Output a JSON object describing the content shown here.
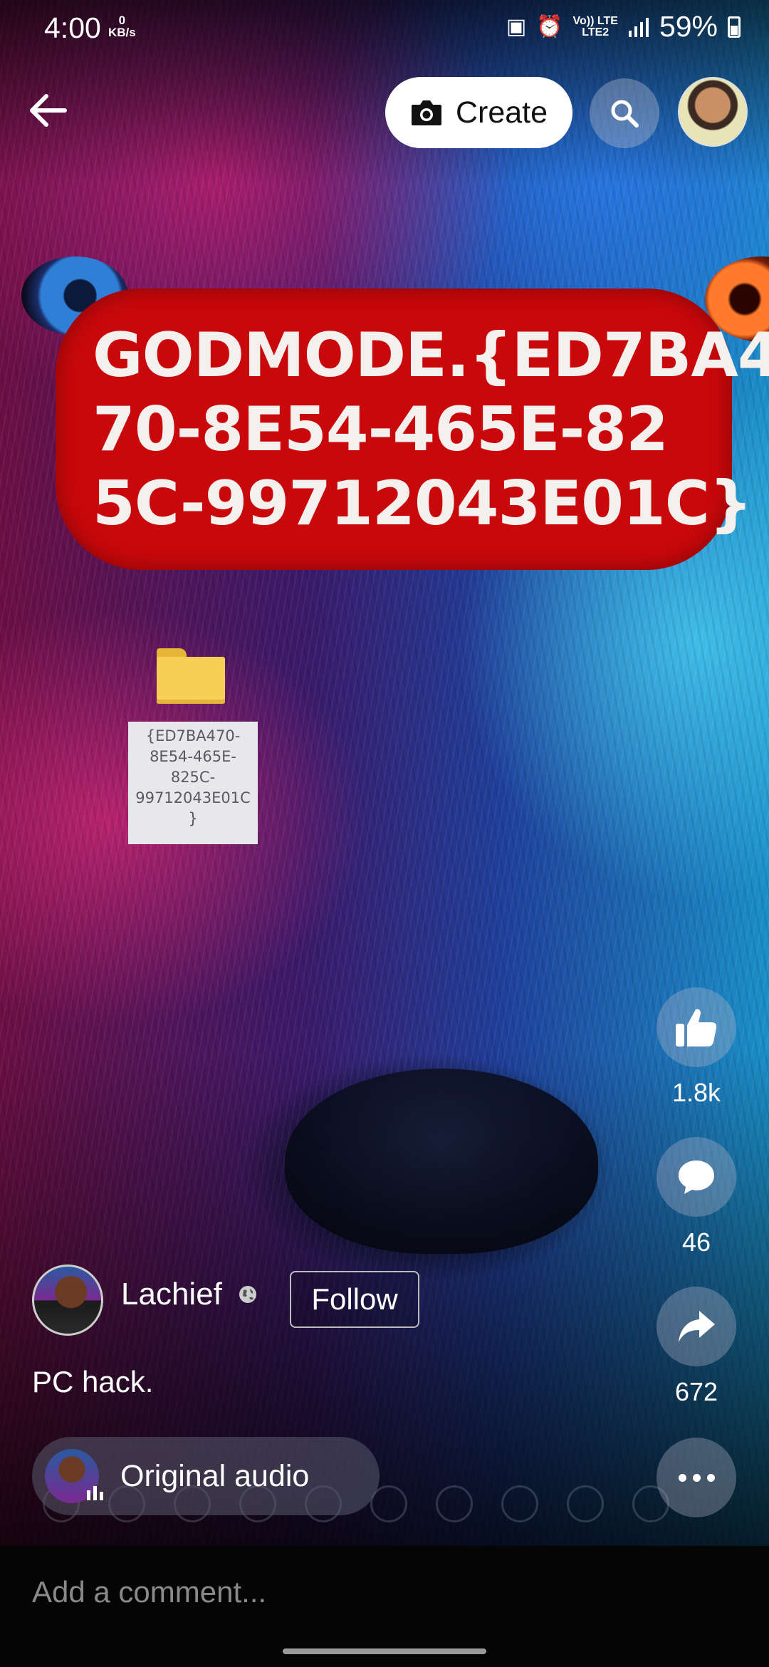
{
  "status_bar": {
    "time": "4:00",
    "net_speed_value": "0",
    "net_speed_unit": "KB/s",
    "signal_text_1": "Vo)) LTE",
    "signal_text_2": "LTE2",
    "battery": "59%"
  },
  "top_bar": {
    "create_label": "Create",
    "icons": [
      "back-arrow-icon",
      "camera-icon",
      "search-icon",
      "profile-avatar"
    ]
  },
  "video": {
    "banner_lines": [
      "GODMODE.{ED7BA4",
      "70-8E54-465E-82",
      "5C-99712043E01C}"
    ],
    "banner_color": "#c8080b",
    "folder_label": "{ED7BA470-\n8E54-465E-\n825C-\n99712043E01C\n}"
  },
  "actions": {
    "like_count": "1.8k",
    "comment_count": "46",
    "share_count": "672"
  },
  "author": {
    "name": "Lachief",
    "follow_label": "Follow",
    "caption": "PC hack."
  },
  "audio": {
    "label": "Original audio"
  },
  "comment": {
    "placeholder": "Add a comment..."
  }
}
